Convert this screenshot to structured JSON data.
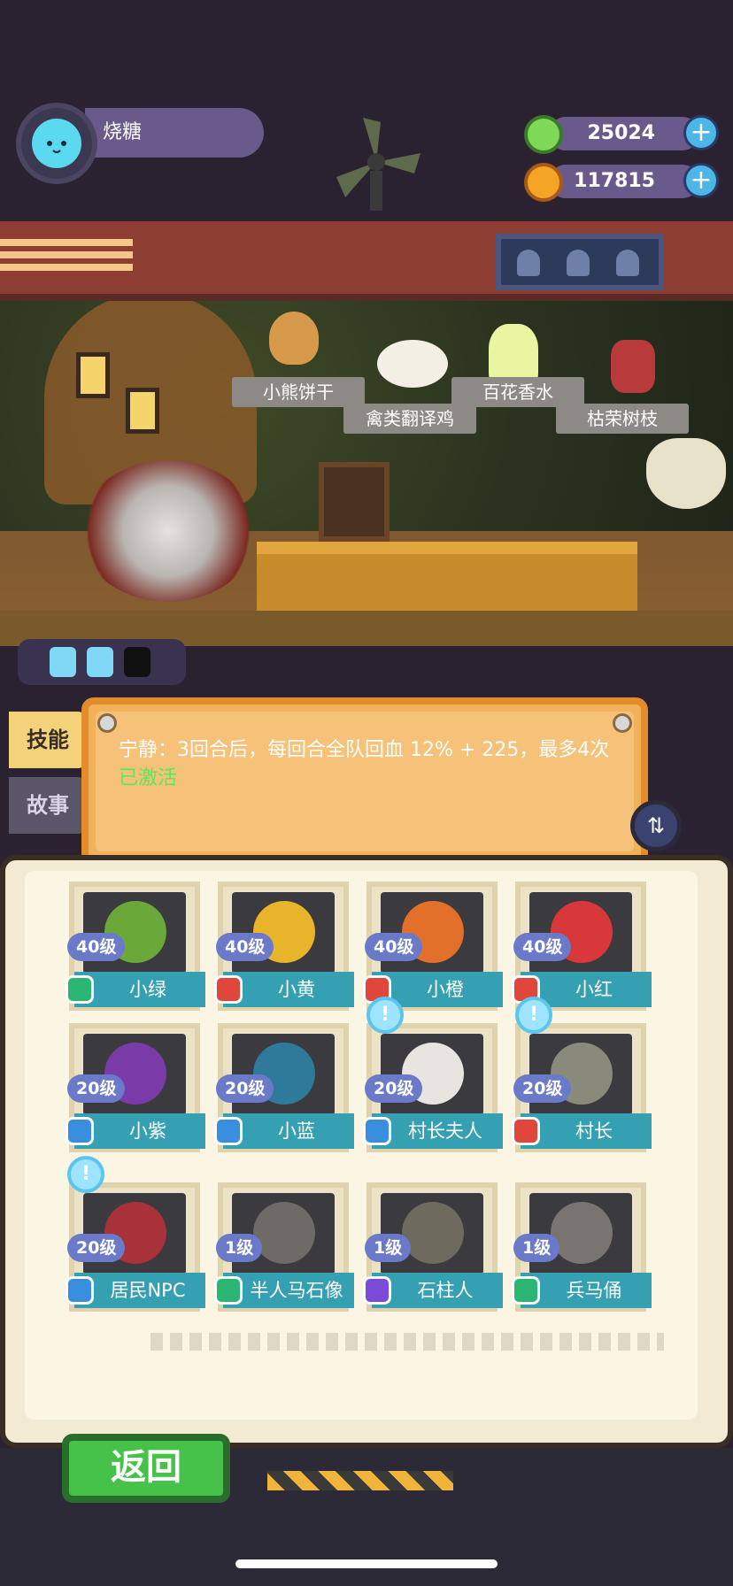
{
  "player": {
    "name": "烧糖"
  },
  "currencies": [
    {
      "icon": "green-gem-icon",
      "value": "25024",
      "color": "#7ed957"
    },
    {
      "icon": "gold-planet-icon",
      "value": "117815",
      "color": "#f5a524"
    }
  ],
  "shelf_items": [
    "小熊饼干",
    "禽类翻译鸡",
    "百花香水",
    "枯荣树枝"
  ],
  "tabs": [
    {
      "label": "技能",
      "active": true
    },
    {
      "label": "故事",
      "active": false
    }
  ],
  "skill": {
    "description": "宁静：3回合后，每回合全队回血 12% + 225，最多4次",
    "status": "已激活"
  },
  "characters": [
    {
      "level": "40级",
      "name": "小绿",
      "role_color": "#2bb673",
      "face_color": "#6aa83a",
      "notice": false
    },
    {
      "level": "40级",
      "name": "小黄",
      "role_color": "#e0463a",
      "face_color": "#e8b42a",
      "notice": false
    },
    {
      "level": "40级",
      "name": "小橙",
      "role_color": "#e0463a",
      "face_color": "#e2702a",
      "notice": false
    },
    {
      "level": "40级",
      "name": "小红",
      "role_color": "#e0463a",
      "face_color": "#d8383a",
      "notice": false
    },
    {
      "level": "20级",
      "name": "小紫",
      "role_color": "#3a8ee0",
      "face_color": "#7a3aa8",
      "notice": false
    },
    {
      "level": "20级",
      "name": "小蓝",
      "role_color": "#3a8ee0",
      "face_color": "#2e7a9a",
      "notice": false
    },
    {
      "level": "20级",
      "name": "村长夫人",
      "role_color": "#3a8ee0",
      "face_color": "#e8e4e0",
      "notice": true
    },
    {
      "level": "20级",
      "name": "村长",
      "role_color": "#e0463a",
      "face_color": "#8a8a7a",
      "notice": true
    },
    {
      "level": "20级",
      "name": "居民NPC",
      "role_color": "#3a8ee0",
      "face_color": "#a8323a",
      "notice": true
    },
    {
      "level": "1级",
      "name": "半人马石像",
      "role_color": "#2bb673",
      "face_color": "#6e6a66",
      "notice": false
    },
    {
      "level": "1级",
      "name": "石柱人",
      "role_color": "#7a4ad8",
      "face_color": "#6e6a5e",
      "notice": false
    },
    {
      "level": "1级",
      "name": "兵马俑",
      "role_color": "#2bb673",
      "face_color": "#7a7470",
      "notice": false
    }
  ],
  "buttons": {
    "return_label": "返回",
    "plus": "+",
    "swap": "⇅"
  }
}
